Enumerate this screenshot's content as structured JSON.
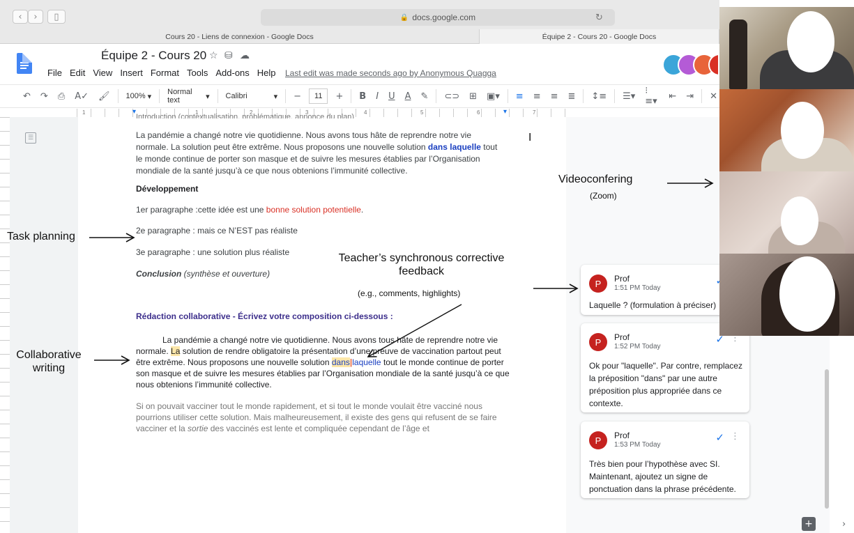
{
  "browser": {
    "url": "docs.google.com",
    "tabs": [
      "Cours 20 - Liens de connexion - Google Docs",
      "Équipe 2 - Cours 20 - Google Docs"
    ],
    "icons": {
      "back": "chevron-left-icon",
      "forward": "chevron-right-icon",
      "sidebar": "sidebar-icon",
      "lock": "lock-icon",
      "reload": "reload-icon"
    }
  },
  "docs": {
    "title": "Équipe 2 - Cours 20",
    "menu": [
      "File",
      "Edit",
      "View",
      "Insert",
      "Format",
      "Tools",
      "Add-ons",
      "Help"
    ],
    "last_edit": "Last edit was made seconds ago by Anonymous Quagga",
    "toolbar": {
      "zoom": "100%",
      "style": "Normal text",
      "font": "Calibri",
      "font_size": "11",
      "minus": "−",
      "plus": "+"
    },
    "ruler_numbers": [
      "1",
      "1",
      "2",
      "3",
      "4",
      "5",
      "6",
      "7"
    ],
    "colors": {
      "doc_blue": "#4285f4",
      "highlight": "#fde7a9",
      "comment_avatar": "#c5221f",
      "link_blue": "#1a3fc0"
    }
  },
  "document": {
    "intro_partial": "Introduction (contextualisation, problématique, annonce du plan)",
    "para1": "La pandémie a changé notre vie quotidienne. Nous avons tous hâte de reprendre notre vie normale. La solution peut être extrême. Nous proposons une nouvelle solution ",
    "para1_highlight": "dans laquelle",
    "para1_end": " tout le monde continue de porter son masque et de suivre les mesures établies par l’Organisation mondiale de la santé jusqu’à ce que nous obtenions l’immunité collective.",
    "dev_heading": "Développement",
    "p1_label": "1er paragraphe :cette idée est une ",
    "p1_red": "bonne solution potentielle",
    "p1_end": ".",
    "p2": "2e paragraphe : mais ce N’EST pas réaliste",
    "p3": "3e paragraphe :  une solution plus réaliste",
    "conclusion_bold": "Conclusion",
    "conclusion_rest": " (synthèse et ouverture)",
    "collab_heading": "Rédaction collaborative - Écrivez votre composition ci-dessous :",
    "collab_line1": "La pandémie a changé notre vie quotidienne. Nous avons tous hâte de reprendre notre vie",
    "collab_line2a": "normale. ",
    "collab_line2_hl": "La",
    "collab_line2b": " solution de rendre obligatoire la présentation d’une preuve de vaccination partout peut",
    "collab_line3a": "être extrême. Nous proposons une nouvelle solution ",
    "collab_line3_dans": "dans",
    "collab_line3_laquelle": "laquelle",
    "collab_line3b": " tout le monde continue de porter",
    "collab_line4": "son masque et de suivre les mesures établies par l’Organisation mondiale de la santé jusqu’à ce que",
    "collab_line5": "nous obtenions l’immunité collective.",
    "last_line1": "Si on pouvait vacciner tout le monde rapidement, et si tout le monde voulait être vacciné nous",
    "last_line2": "pourrions utiliser cette solution. Mais malheureusement, il existe des gens qui refusent de se faire",
    "last_line3a": "vacciner et la ",
    "last_line3_it": "sortie",
    "last_line3b": " des vaccinés est lente et compliquée cependant de l’âge et"
  },
  "comments": [
    {
      "initial": "P",
      "author": "Prof",
      "time": "1:51 PM Today",
      "body": "Laquelle ? (formulation à préciser)"
    },
    {
      "initial": "P",
      "author": "Prof",
      "time": "1:52 PM Today",
      "body": "Ok pour \"laquelle\". Par contre, remplacez la préposition \"dans\" par une autre préposition plus appropriée dans ce contexte."
    },
    {
      "initial": "P",
      "author": "Prof",
      "time": "1:53 PM Today",
      "body": "Très bien pour l’hypothèse avec SI. Maintenant, ajoutez un signe de ponctuation dans la phrase précédente."
    }
  ],
  "annotations": {
    "task_planning": "Task planning",
    "collaborative": "Collaborative writing",
    "teacher_main": "Teacher’s synchronous corrective feedback",
    "teacher_sub": "(e.g., comments, highlights)",
    "video": "Videoconfering",
    "video_sub": "(Zoom)"
  }
}
